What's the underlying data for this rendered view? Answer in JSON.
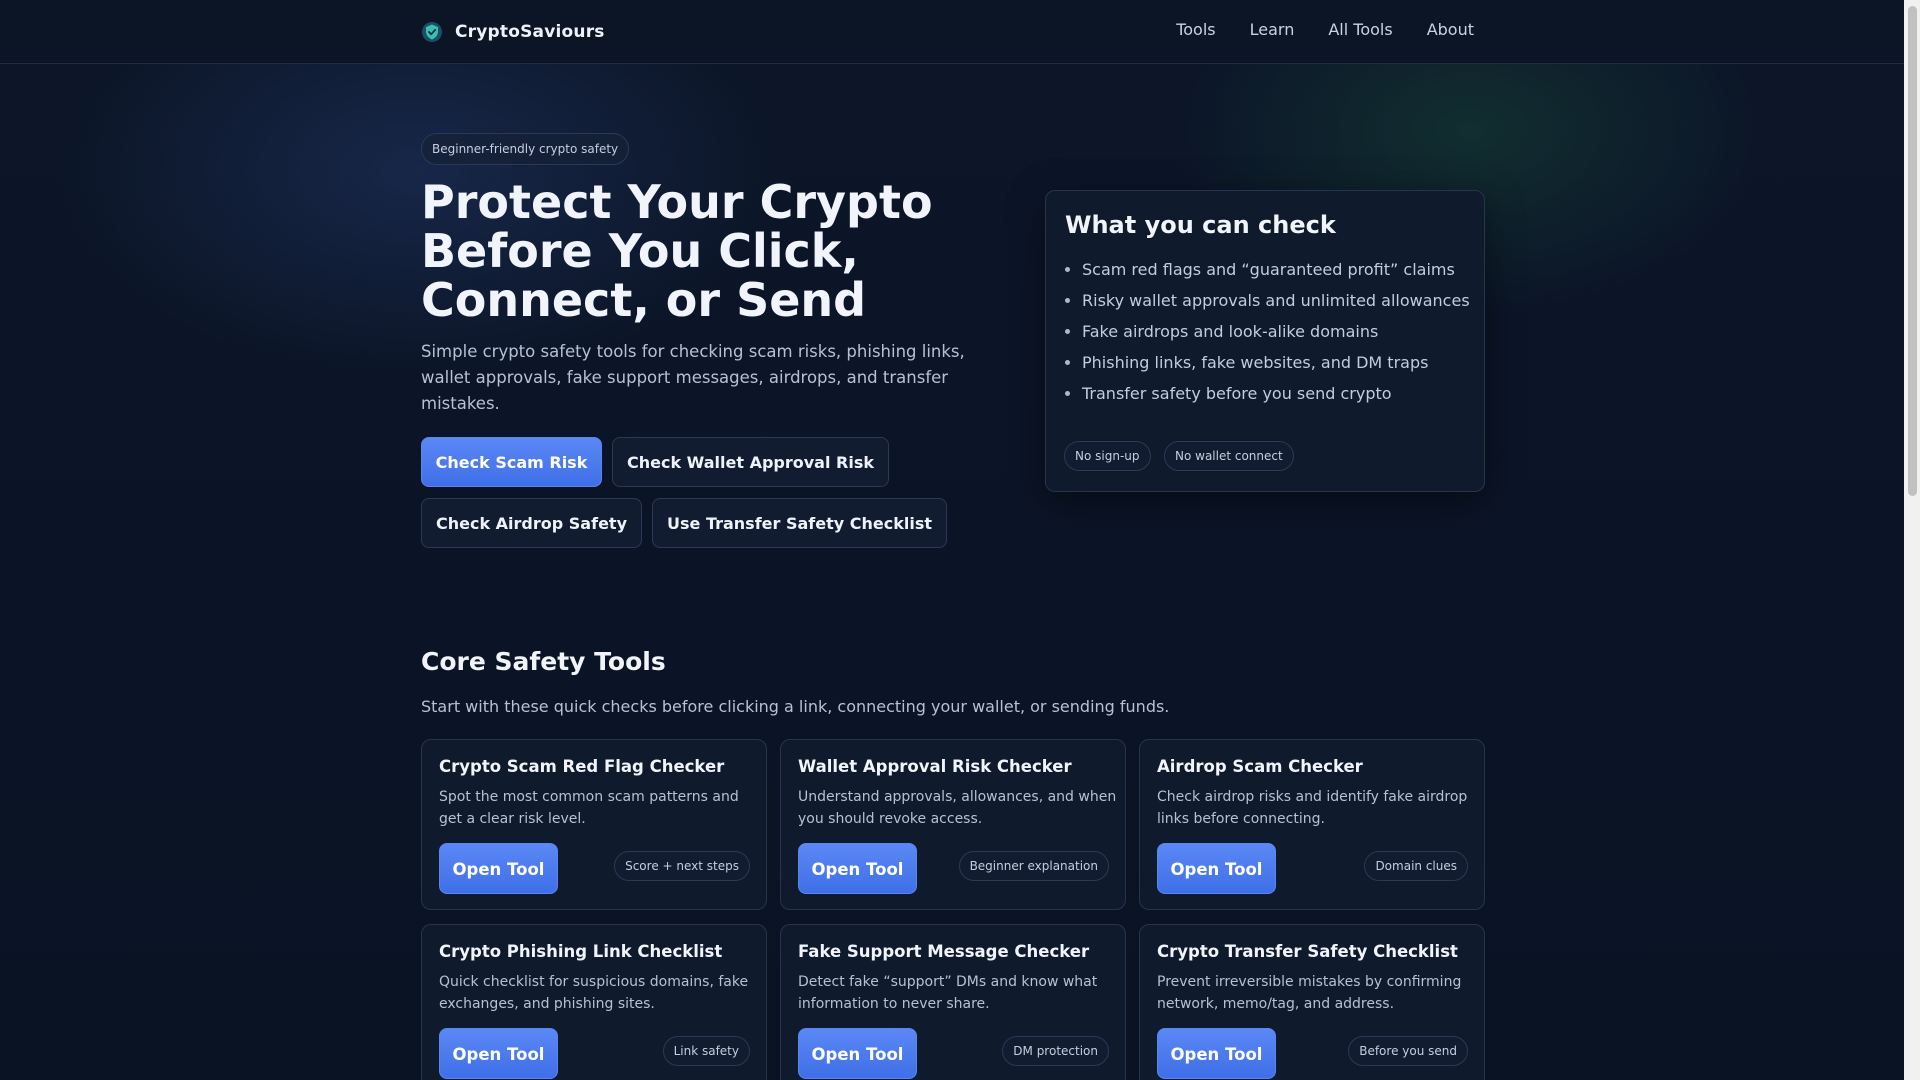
{
  "header": {
    "brand_name": "CryptoSaviours",
    "nav": [
      "Tools",
      "Learn",
      "All Tools",
      "About"
    ]
  },
  "hero": {
    "pill": "Beginner-friendly crypto safety",
    "title": "Protect Your Crypto Before You Click, Connect, or Send",
    "subtitle": "Simple crypto safety tools for checking scam risks, phishing links, wallet approvals, fake support messages, airdrops, and transfer mistakes.",
    "buttons": [
      "Check Scam Risk",
      "Check Wallet Approval Risk",
      "Check Airdrop Safety",
      "Use Transfer Safety Checklist"
    ]
  },
  "check_card": {
    "title": "What you can check",
    "items": [
      "Scam red flags and “guaranteed profit” claims",
      "Risky wallet approvals and unlimited allowances",
      "Fake airdrops and look-alike domains",
      "Phishing links, fake websites, and DM traps",
      "Transfer safety before you send crypto"
    ],
    "badges": [
      "No sign-up",
      "No wallet connect"
    ]
  },
  "section": {
    "title": "Core Safety Tools",
    "subtitle": "Start with these quick checks before clicking a link, connecting your wallet, or sending funds."
  },
  "tools": [
    {
      "title": "Crypto Scam Red Flag Checker",
      "desc": "Spot the most common scam patterns and get a clear risk level.",
      "button": "Open Tool",
      "badge": "Score + next steps"
    },
    {
      "title": "Wallet Approval Risk Checker",
      "desc": "Understand approvals, allowances, and when you should revoke access.",
      "button": "Open Tool",
      "badge": "Beginner explanation"
    },
    {
      "title": "Airdrop Scam Checker",
      "desc": "Check airdrop risks and identify fake airdrop links before connecting.",
      "button": "Open Tool",
      "badge": "Domain clues"
    },
    {
      "title": "Crypto Phishing Link Checklist",
      "desc": "Quick checklist for suspicious domains, fake exchanges, and phishing sites.",
      "button": "Open Tool",
      "badge": "Link safety"
    },
    {
      "title": "Fake Support Message Checker",
      "desc": "Detect fake “support” DMs and know what information to never share.",
      "button": "Open Tool",
      "badge": "DM protection"
    },
    {
      "title": "Crypto Transfer Safety Checklist",
      "desc": "Prevent irreversible mistakes by confirming network, memo/tag, and address.",
      "button": "Open Tool",
      "badge": "Before you send"
    }
  ],
  "colors": {
    "background": "#0b1426",
    "card": "#0f1a2d",
    "border": "#27344e",
    "accent": "#4a7bef",
    "logo_teal": "#2fb39a"
  }
}
